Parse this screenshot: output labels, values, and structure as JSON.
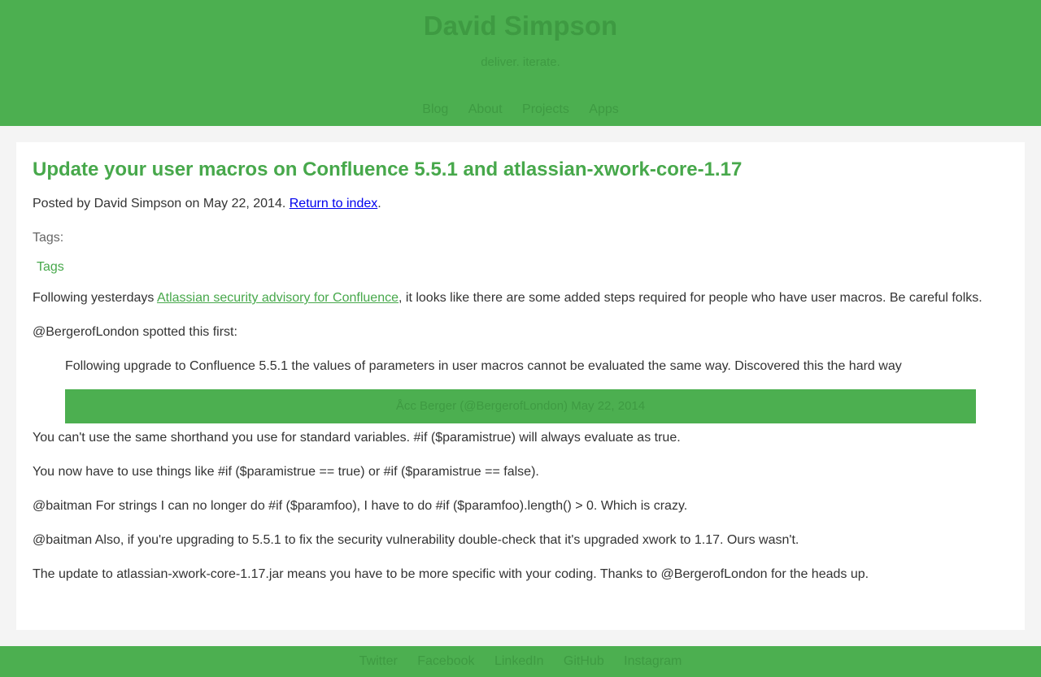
{
  "site": {
    "title": "David Simpson",
    "tagline": "deliver. iterate."
  },
  "nav": {
    "items": [
      "Blog",
      "About",
      "Projects",
      "Apps"
    ]
  },
  "post": {
    "title": "Update your user macros on Confluence 5.5.1 and atlassian-xwork-core-1.17",
    "meta_prefix": "Posted by David Simpson on May 22, 2014. ",
    "return_link": "Return to index",
    "meta_suffix": ".",
    "tags_label": "Tags:",
    "tag": "Tags",
    "p1_before": "Following yesterdays ",
    "p1_link": "Atlassian security advisory for Confluence",
    "p1_after": ", it looks like there are some added steps required for people who have user macros. Be careful folks.",
    "p2": "@BergerofLondon spotted this first:",
    "quote_text": "Following upgrade to Confluence 5.5.1 the values of parameters in user macros cannot be evaluated the same way. Discovered this the hard way",
    "quote_cite": "Åcc     Berger (@BergerofLondon) May 22, 2014",
    "p3": "You can't use the same shorthand you use for standard variables. #if ($paramistrue) will always evaluate as true.",
    "p4": "You now have to use things like #if ($paramistrue == true) or #if ($paramistrue == false).",
    "p5": "@baitman For strings I can no longer do #if ($paramfoo), I have to do #if ($paramfoo).length() > 0. Which is crazy.",
    "p6": "@baitman Also, if you're upgrading to 5.5.1 to fix the security vulnerability double-check that it's upgraded xwork to 1.17. Ours wasn't.",
    "p7": "The update to atlassian-xwork-core-1.17.jar means you have to be more specific with your coding. Thanks to @BergerofLondon for the heads up."
  },
  "footer": {
    "links": [
      "Twitter",
      "Facebook",
      "LinkedIn",
      "GitHub",
      "Instagram"
    ]
  }
}
